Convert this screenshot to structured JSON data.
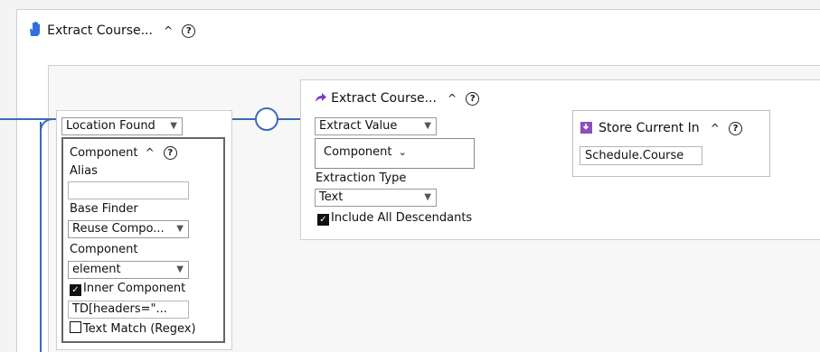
{
  "outer": {
    "title": "Extract Course...",
    "caret": "^",
    "help": "?"
  },
  "location": {
    "dropdown": "Location Found",
    "component_header": "Component",
    "alias_label": "Alias",
    "alias_value": "",
    "base_finder_label": "Base Finder",
    "base_finder_value": "Reuse Compo...",
    "component_label": "Component",
    "component_value": "element",
    "inner_component_label": "Inner Component",
    "inner_component_checked": true,
    "inner_value": "TD[headers=\"...",
    "text_match_label": "Text Match (Regex)",
    "text_match_checked": false
  },
  "extract": {
    "title": "Extract Course...",
    "dropdown": "Extract Value",
    "component_value": "Component",
    "extraction_type_label": "Extraction Type",
    "extraction_type_value": "Text",
    "include_descendants_label": "Include All Descendants",
    "include_descendants_checked": true
  },
  "store": {
    "title": "Store Current In",
    "value": "Schedule.Course"
  },
  "colors": {
    "blue_line": "#3b6bb5",
    "purple_line": "#8a4fb8",
    "hand_icon": "#2f6fe0",
    "share_icon": "#7a3fc0",
    "store_icon": "#8a4fb8"
  }
}
